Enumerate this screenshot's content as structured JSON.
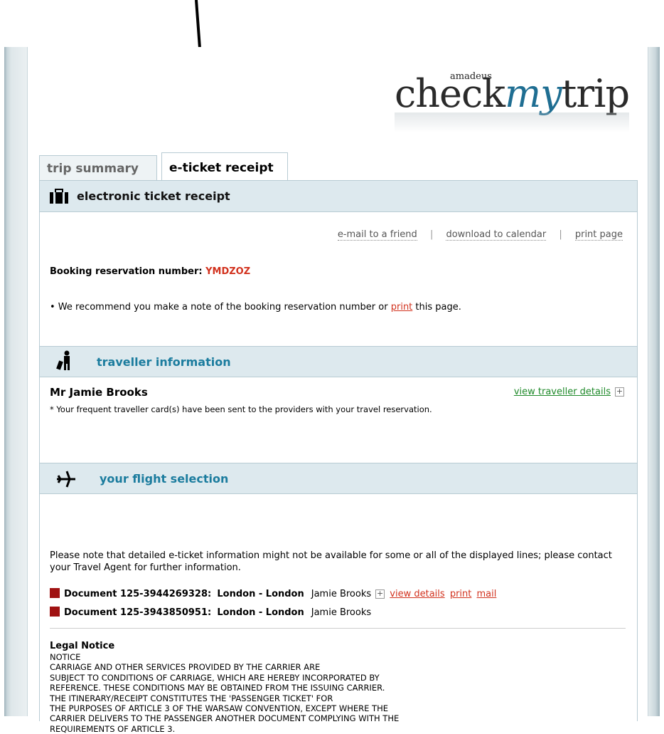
{
  "logo": {
    "brand": "amadeus",
    "product_prefix": "check",
    "product_my": "my",
    "product_suffix": "trip"
  },
  "tabs": [
    {
      "label": "trip summary",
      "active": false
    },
    {
      "label": "e-ticket receipt",
      "active": true
    }
  ],
  "receipt": {
    "header": "electronic ticket receipt",
    "actions": [
      "e-mail to a friend",
      "download to calendar",
      "print page"
    ],
    "booking_label": "Booking reservation number:",
    "booking_ref": "YMDZOZ",
    "recommend_prefix": "• We recommend you make a note of the booking reservation number or",
    "recommend_link": "print",
    "recommend_suffix": "this page."
  },
  "traveller": {
    "header": "traveller information",
    "name": "Mr Jamie Brooks",
    "view_details": "view traveller details",
    "note": "* Your frequent traveller card(s) have been sent to the providers with your travel reservation."
  },
  "flight": {
    "header": "your flight selection",
    "note": "Please note that detailed e-ticket information might not be available for some or all of the displayed lines; please contact your Travel Agent for further information.",
    "documents": [
      {
        "label": "Document 125-3944269328:",
        "route": "London - London",
        "passenger": "Jamie Brooks",
        "actions": [
          "view details",
          "print",
          "mail"
        ]
      },
      {
        "label": "Document 125-3943850951:",
        "route": "London - London",
        "passenger": "Jamie Brooks",
        "actions": []
      }
    ]
  },
  "legal": {
    "title": "Legal Notice",
    "body": "NOTICE\nCARRIAGE AND OTHER SERVICES PROVIDED BY THE CARRIER ARE\nSUBJECT TO CONDITIONS OF CARRIAGE, WHICH ARE HEREBY INCORPORATED BY\nREFERENCE. THESE CONDITIONS MAY BE OBTAINED FROM THE ISSUING CARRIER.\nTHE ITINERARY/RECEIPT CONSTITUTES THE 'PASSENGER TICKET' FOR\nTHE PURPOSES OF ARTICLE 3 OF THE WARSAW CONVENTION, EXCEPT WHERE THE\nCARRIER DELIVERS TO THE PASSENGER ANOTHER DOCUMENT COMPLYING WITH THE\nREQUIREMENTS OF ARTICLE 3."
  },
  "colors": {
    "accent_red": "#d2321e",
    "section_blue": "#1b7c9e",
    "header_bg": "#dde9ee",
    "link_green": "#1f8a2a"
  }
}
